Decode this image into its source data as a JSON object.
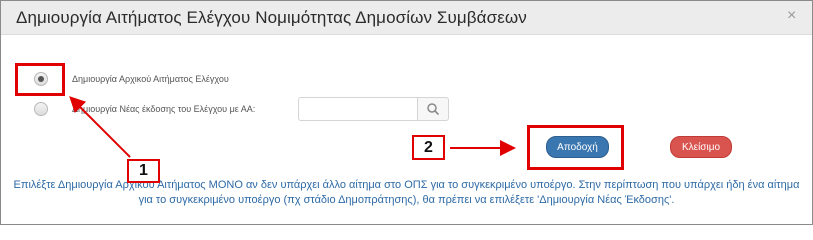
{
  "modal": {
    "title": "Δημιουργία Αιτήματος Ελέγχου Νομιμότητας Δημοσίων Συμβάσεων",
    "close_symbol": "×"
  },
  "options": [
    {
      "label": "Δημιουργία Αρχικού Αιτήματος Ελέγχου",
      "selected": true
    },
    {
      "label": "Δημιουργία Νέας έκδοσης του Ελέγχου με ΑΑ:",
      "selected": false
    }
  ],
  "search": {
    "value": "",
    "placeholder": "",
    "icon": "search-icon"
  },
  "buttons": {
    "accept_label": "Αποδοχή",
    "close_label": "Κλείσιμο"
  },
  "annotations": {
    "step1": "1",
    "step2": "2"
  },
  "info": {
    "text": "Επιλέξτε Δημιουργία Αρχικού Αιτήματος ΜΟΝΟ αν δεν υπάρχει άλλο αίτημα στο ΟΠΣ για το συγκεκριμένο υποέργο. Στην περίπτωση που υπάρχει ήδη ένα αίτημα για το συγκεκριμένο υποέργο (πχ στάδιο Δημοπράτησης), θα πρέπει να επιλέξετε 'Δημιουργία Νέας Έκδοσης'."
  },
  "colors": {
    "accept": "#3a76b0",
    "close": "#d9534f",
    "annotation": "#e00000",
    "info_text": "#2d6aa6"
  }
}
